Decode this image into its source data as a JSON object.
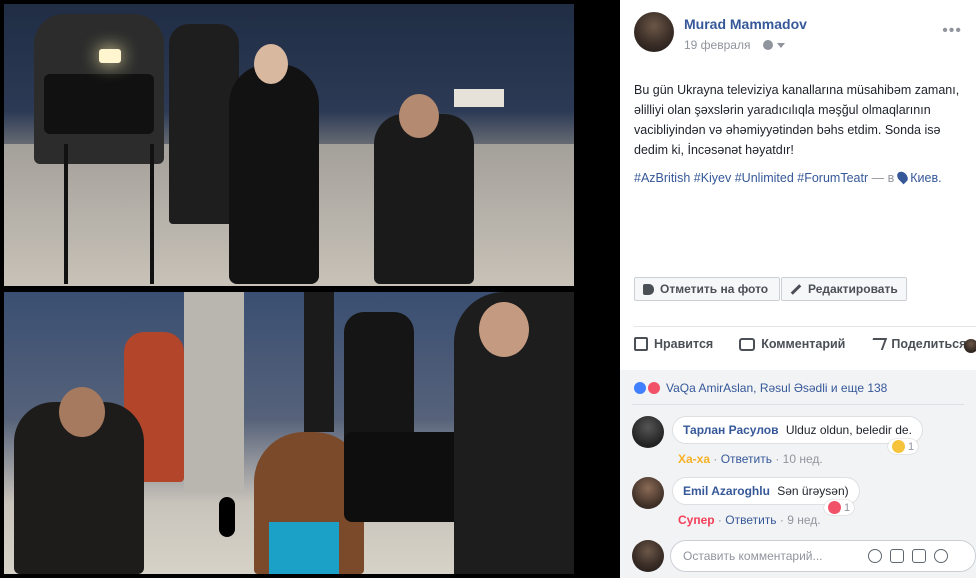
{
  "post": {
    "author": "Murad Mammadov",
    "date": "19 февраля",
    "body": "Bu gün Ukrayna televiziya kanallarına müsahibəm zamanı, əlilliyi olan şəxslərin yaradıcılıqla məşğul olmaqlarının vacibliyindən və əhəmiyyətindən bəhs etdim. Sonda isə dedim ki, İncəsənət həyatdır!",
    "hashtags": "#AzBritish #Kiyev #Unlimited #ForumTeatr",
    "location_prefix": "— в",
    "location": "Киев.",
    "more": "•••"
  },
  "toolbar": {
    "tag_label": "Отметить на фото",
    "edit_label": "Редактировать"
  },
  "actions": {
    "like": "Нравится",
    "comment": "Комментарий",
    "share": "Поделиться"
  },
  "reactions": {
    "summary": "VaQa AmirAslan, Rəsul Əsədli и еще 138"
  },
  "comments": [
    {
      "name": "Тарлан Расулов",
      "text": "Ulduz oldun, beledir de.",
      "reaction_word": "Ха-ха",
      "reply": "Ответить",
      "time": "10 нед.",
      "count": "1"
    },
    {
      "name": "Emil Azaroghlu",
      "text": "Sən ürəysən)",
      "reaction_word": "Супер",
      "reply": "Ответить",
      "time": "9 нед.",
      "count": "1"
    }
  ],
  "composer": {
    "placeholder": "Оставить комментарий..."
  },
  "colors": {
    "link": "#365899",
    "meta": "#90949c",
    "haha": "#f7b125",
    "love": "#f33e58"
  },
  "icons": [
    "globe-icon",
    "chevron-down-icon",
    "tag-icon",
    "pencil-icon",
    "like-icon",
    "comment-icon",
    "share-icon",
    "map-pin-icon",
    "emoji-icon",
    "camera-icon",
    "gif-icon",
    "sticker-icon"
  ]
}
